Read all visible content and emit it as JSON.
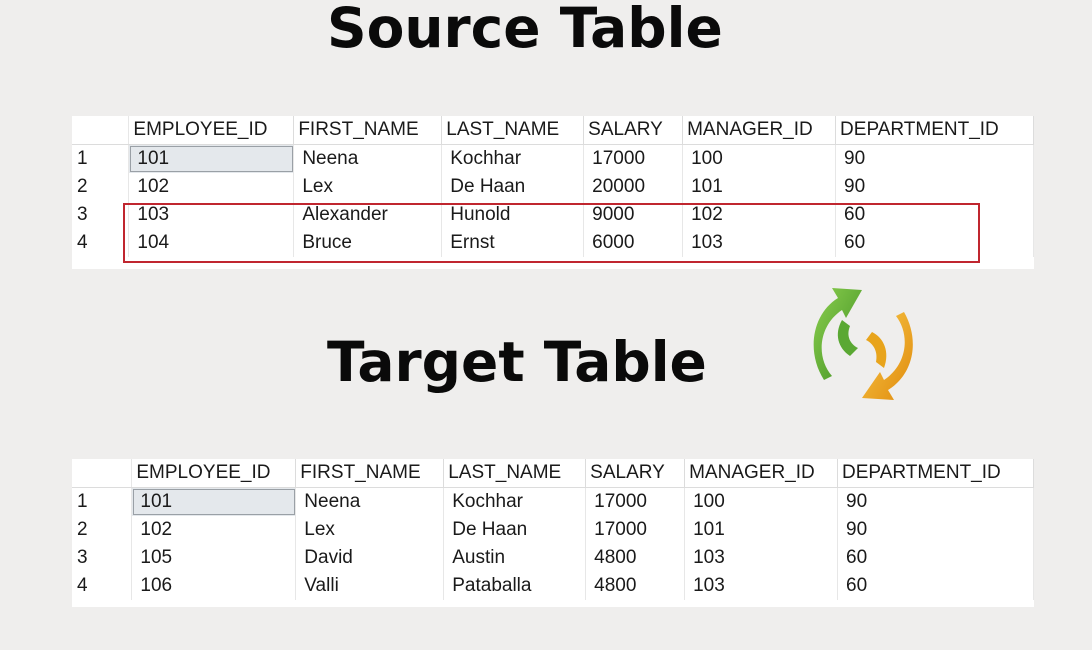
{
  "source": {
    "title": "Source Table",
    "columns": [
      "EMPLOYEE_ID",
      "FIRST_NAME",
      "LAST_NAME",
      "SALARY",
      "MANAGER_ID",
      "DEPARTMENT_ID"
    ],
    "rows": [
      {
        "num": "1",
        "employee_id": "101",
        "first_name": "Neena",
        "last_name": "Kochhar",
        "salary": "17000",
        "manager_id": "100",
        "department_id": "90"
      },
      {
        "num": "2",
        "employee_id": "102",
        "first_name": "Lex",
        "last_name": "De Haan",
        "salary": "20000",
        "manager_id": "101",
        "department_id": "90"
      },
      {
        "num": "3",
        "employee_id": "103",
        "first_name": "Alexander",
        "last_name": "Hunold",
        "salary": "9000",
        "manager_id": "102",
        "department_id": "60"
      },
      {
        "num": "4",
        "employee_id": "104",
        "first_name": "Bruce",
        "last_name": "Ernst",
        "salary": "6000",
        "manager_id": "103",
        "department_id": "60"
      }
    ]
  },
  "target": {
    "title": "Target Table",
    "columns": [
      "EMPLOYEE_ID",
      "FIRST_NAME",
      "LAST_NAME",
      "SALARY",
      "MANAGER_ID",
      "DEPARTMENT_ID"
    ],
    "rows": [
      {
        "num": "1",
        "employee_id": "101",
        "first_name": "Neena",
        "last_name": "Kochhar",
        "salary": "17000",
        "manager_id": "100",
        "department_id": "90"
      },
      {
        "num": "2",
        "employee_id": "102",
        "first_name": "Lex",
        "last_name": "De Haan",
        "salary": "17000",
        "manager_id": "101",
        "department_id": "90"
      },
      {
        "num": "3",
        "employee_id": "105",
        "first_name": "David",
        "last_name": "Austin",
        "salary": "4800",
        "manager_id": "103",
        "department_id": "60"
      },
      {
        "num": "4",
        "employee_id": "106",
        "first_name": "Valli",
        "last_name": "Pataballa",
        "salary": "4800",
        "manager_id": "103",
        "department_id": "60"
      }
    ]
  },
  "highlight": {
    "table": "source",
    "rows": [
      3,
      4
    ],
    "color": "#c0262f"
  },
  "icons": {
    "sync": "sync-arrows-icon"
  },
  "colors": {
    "background": "#efeeed",
    "grid": "#ffffff",
    "selection": "#e4e8ec",
    "arrow_green": "#6cb33f",
    "arrow_orange": "#f3a91c"
  }
}
